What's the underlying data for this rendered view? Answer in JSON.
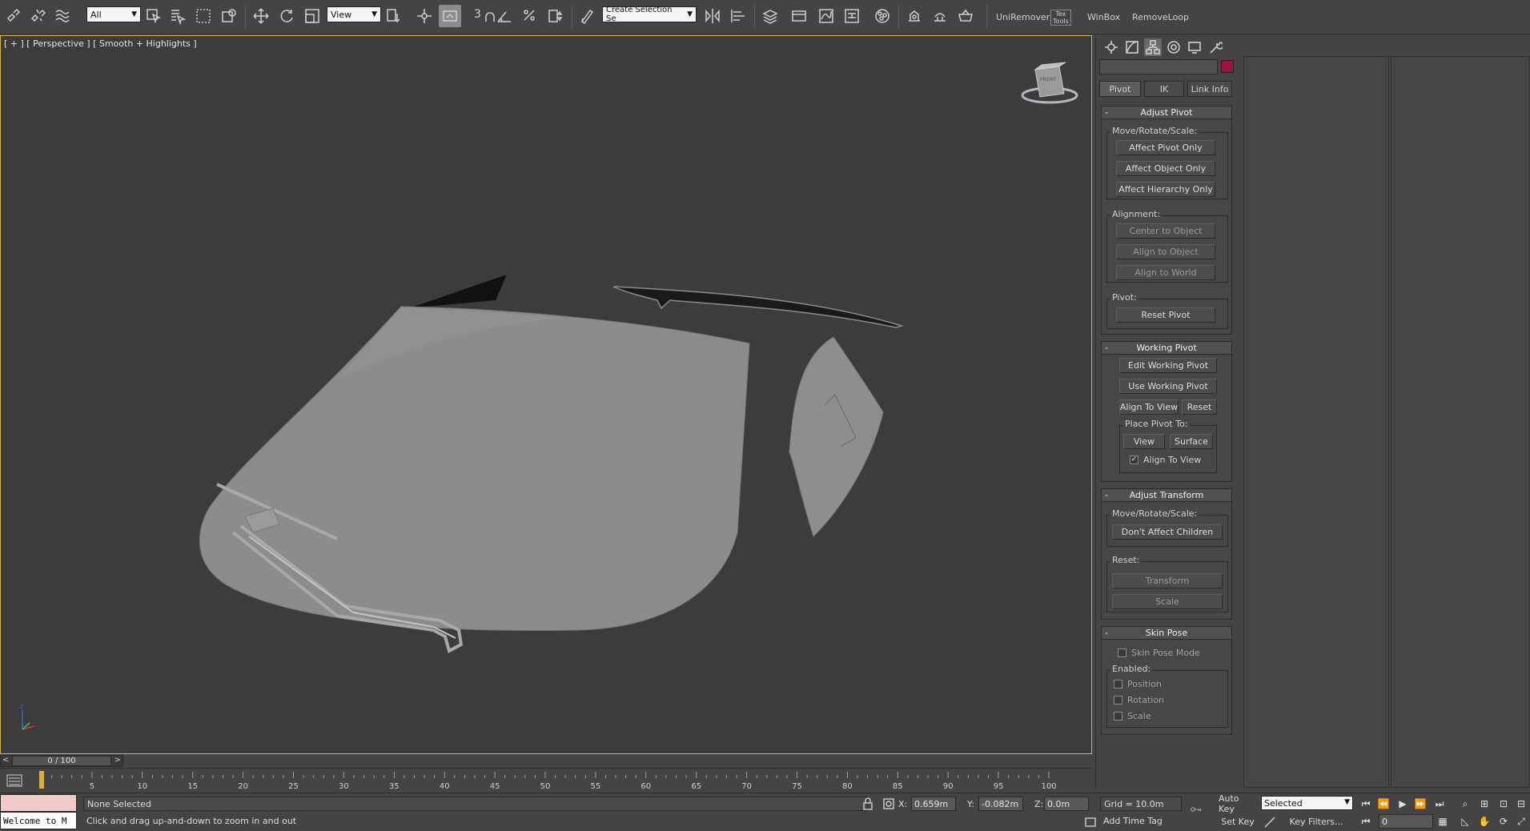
{
  "toolbar": {
    "filter_select": "All",
    "refcoord_select": "View",
    "selection_set_select": "Create Selection Se",
    "snap_label": "3",
    "custom_buttons": [
      "UniRemover",
      "Tex Tools",
      "WinBox",
      "RemoveLoop"
    ]
  },
  "viewport": {
    "label": "[ + ] [ Perspective ] [ Smooth + Highlights ]",
    "viewcube_label": "FRONT"
  },
  "command_panel": {
    "tabs": [
      "create",
      "modify",
      "hierarchy",
      "motion",
      "display",
      "utilities"
    ],
    "active_tab": "hierarchy",
    "object_color": "#a01040",
    "subtabs": [
      "Pivot",
      "IK",
      "Link Info"
    ],
    "active_subtab": "Pivot",
    "adjust_pivot": {
      "title": "Adjust Pivot",
      "move_group": "Move/Rotate/Scale:",
      "affect_pivot_only": "Affect Pivot Only",
      "affect_object_only": "Affect Object Only",
      "affect_hierarchy_only": "Affect Hierarchy Only",
      "alignment_group": "Alignment:",
      "center_to_object": "Center to Object",
      "align_to_object": "Align to Object",
      "align_to_world": "Align to World",
      "pivot_group": "Pivot:",
      "reset_pivot": "Reset Pivot"
    },
    "working_pivot": {
      "title": "Working Pivot",
      "edit_working_pivot": "Edit Working Pivot",
      "use_working_pivot": "Use Working Pivot",
      "align_to_view": "Align To View",
      "reset": "Reset",
      "place_group": "Place Pivot To:",
      "view": "View",
      "surface": "Surface",
      "align_to_view_check": "Align To View",
      "align_to_view_checked": true
    },
    "adjust_transform": {
      "title": "Adjust Transform",
      "move_group": "Move/Rotate/Scale:",
      "dont_affect_children": "Don't Affect Children",
      "reset_group": "Reset:",
      "transform": "Transform",
      "scale": "Scale"
    },
    "skin_pose": {
      "title": "Skin Pose",
      "skin_pose_mode": "Skin Pose Mode",
      "enabled_group": "Enabled:",
      "position": "Position",
      "rotation": "Rotation",
      "scale": "Scale"
    }
  },
  "timeline": {
    "slider_label": "0 / 100",
    "ticks": [
      "5",
      "10",
      "15",
      "20",
      "25",
      "30",
      "35",
      "40",
      "45",
      "50",
      "55",
      "60",
      "65",
      "70",
      "75",
      "80",
      "85",
      "90",
      "95",
      "100"
    ]
  },
  "status": {
    "maxscript_text": "Welcome to M",
    "selection": "None Selected",
    "prompt": "Click and drag up-and-down to zoom in and out",
    "x_label": "X:",
    "x_value": "0.659m",
    "y_label": "Y:",
    "y_value": "-0.082m",
    "z_label": "Z:",
    "z_value": "0.0m",
    "grid": "Grid = 10.0m",
    "add_time_tag": "Add Time Tag",
    "auto_key": "Auto Key",
    "set_key": "Set Key",
    "key_mode": "Selected",
    "key_filters": "Key Filters...",
    "current_frame": "0"
  }
}
